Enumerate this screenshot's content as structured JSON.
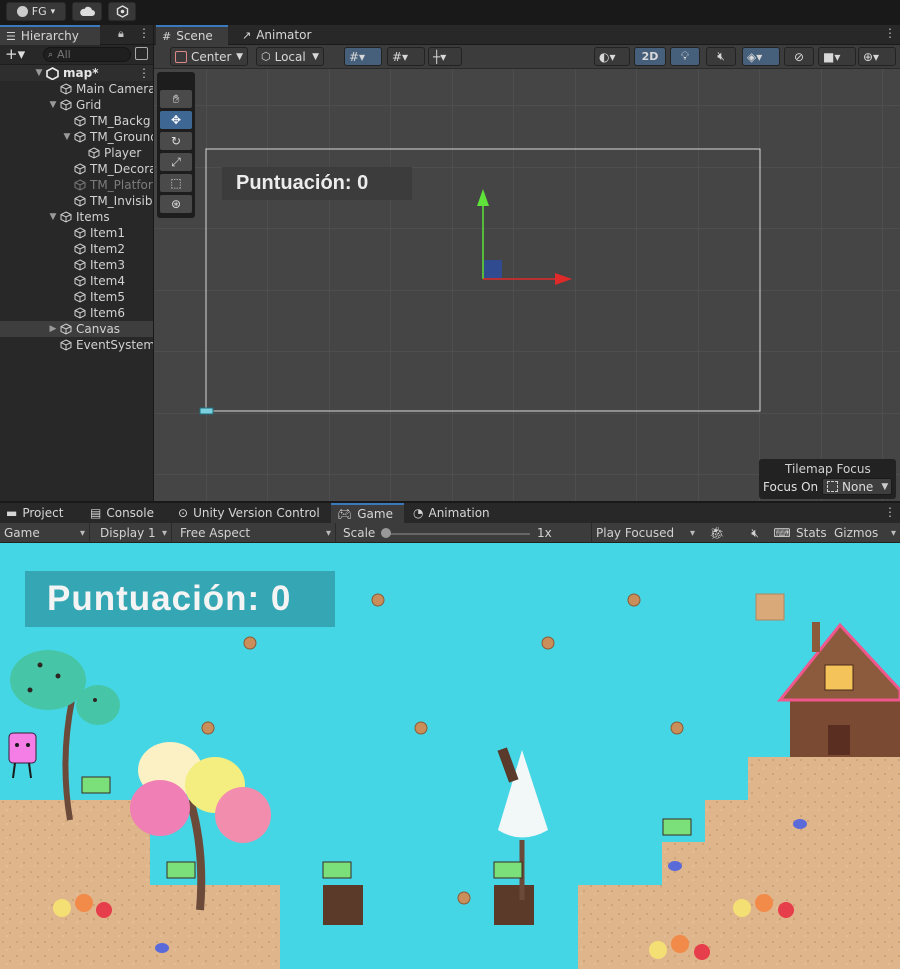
{
  "topbar": {
    "account_label": "FG"
  },
  "hierarchy": {
    "tab_label": "Hierarchy",
    "search_placeholder": "All",
    "scene_name": "map*",
    "items": [
      {
        "label": "Main Camera",
        "indent": 1
      },
      {
        "label": "Grid",
        "indent": 1,
        "expanded": true
      },
      {
        "label": "TM_Backg",
        "indent": 2
      },
      {
        "label": "TM_Ground",
        "indent": 2,
        "expanded": true
      },
      {
        "label": "Player",
        "indent": 3
      },
      {
        "label": "TM_Decora",
        "indent": 2
      },
      {
        "label": "TM_Platfor",
        "indent": 2,
        "dim": true
      },
      {
        "label": "TM_Invisib",
        "indent": 2
      },
      {
        "label": "Items",
        "indent": 1,
        "expanded": true
      },
      {
        "label": "Item1",
        "indent": 2
      },
      {
        "label": "Item2",
        "indent": 2
      },
      {
        "label": "Item3",
        "indent": 2
      },
      {
        "label": "Item4",
        "indent": 2
      },
      {
        "label": "Item5",
        "indent": 2
      },
      {
        "label": "Item6",
        "indent": 2
      },
      {
        "label": "Canvas",
        "indent": 1,
        "collapsed": true,
        "selected": true
      },
      {
        "label": "EventSystem",
        "indent": 1
      }
    ]
  },
  "scene": {
    "tabs": [
      "Scene",
      "Animator"
    ],
    "pivot_label": "Center",
    "space_label": "Local",
    "mode_2d_label": "2D",
    "score_text": "Puntuación: 0",
    "tilemap_focus": {
      "title": "Tilemap Focus",
      "label": "Focus On",
      "value": "None"
    }
  },
  "bottom_tabs": [
    "Project",
    "Console",
    "Unity Version Control",
    "Game",
    "Animation"
  ],
  "game_bar": {
    "mode": "Game",
    "display": "Display 1",
    "aspect": "Free Aspect",
    "scale_label": "Scale",
    "scale_value": "1x",
    "play_mode": "Play Focused",
    "stats": "Stats",
    "gizmos": "Gizmos"
  },
  "game": {
    "score_text": "Puntuación: 0",
    "sky_color": "#45d6e6"
  }
}
